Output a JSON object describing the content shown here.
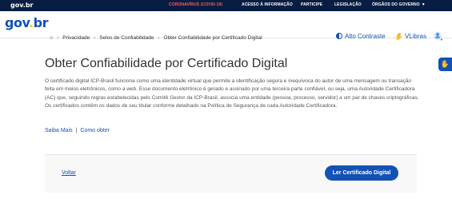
{
  "topbar": {
    "brand": "gov.br",
    "links": [
      {
        "label": "CORONAVÍRUS (COVID-19)",
        "color": "#ff5b5b"
      },
      {
        "label": "ACESSO À INFORMAÇÃO"
      },
      {
        "label": "PARTICIPE"
      },
      {
        "label": "LEGISLAÇÃO"
      },
      {
        "label": "ÓRGÃOS DO GOVERNO"
      }
    ],
    "dropdown_icon": "chevron-down-icon"
  },
  "header": {
    "logo": {
      "main": "gov",
      "dot": ".",
      "tail": "br"
    },
    "alto_contraste": "Alto Contraste",
    "vlibras": "VLibras"
  },
  "breadcrumb": {
    "items": [
      "Privacidade",
      "Selos de Confiabilidade",
      "Obter Confiabilidade por Certificado Digital"
    ]
  },
  "page": {
    "title": "Obter Confiabilidade por Certificado Digital",
    "description": "O certificado digital ICP-Brasil funciona como uma identidade virtual que permite a identificação segura e inequívoca do autor de uma mensagem ou transação feita em meios eletrônicos, como a web. Esse documento eletrônico é gerado e assinado por uma terceira parte confiável, ou seja, uma Autoridade Certificadora (AC) que, seguindo regras estabelecidas pelo Comitê Gestor da ICP-Brasil, associa uma entidade (pessoa, processo, servidor) a um par de chaves criptográficas. Os certificados contêm os dados de seu titular conforme detalhado na Política de Segurança de cada Autoridade Certificadora.",
    "saiba_mais": "Saiba Mais",
    "separator": "|",
    "como_obter": "Como obter"
  },
  "actions": {
    "voltar": "Voltar",
    "ler_certificado": "Ler Certificado Digital"
  },
  "colors": {
    "primary": "#1351b4",
    "topbar": "#071d41",
    "covid": "#ff5b5b"
  }
}
